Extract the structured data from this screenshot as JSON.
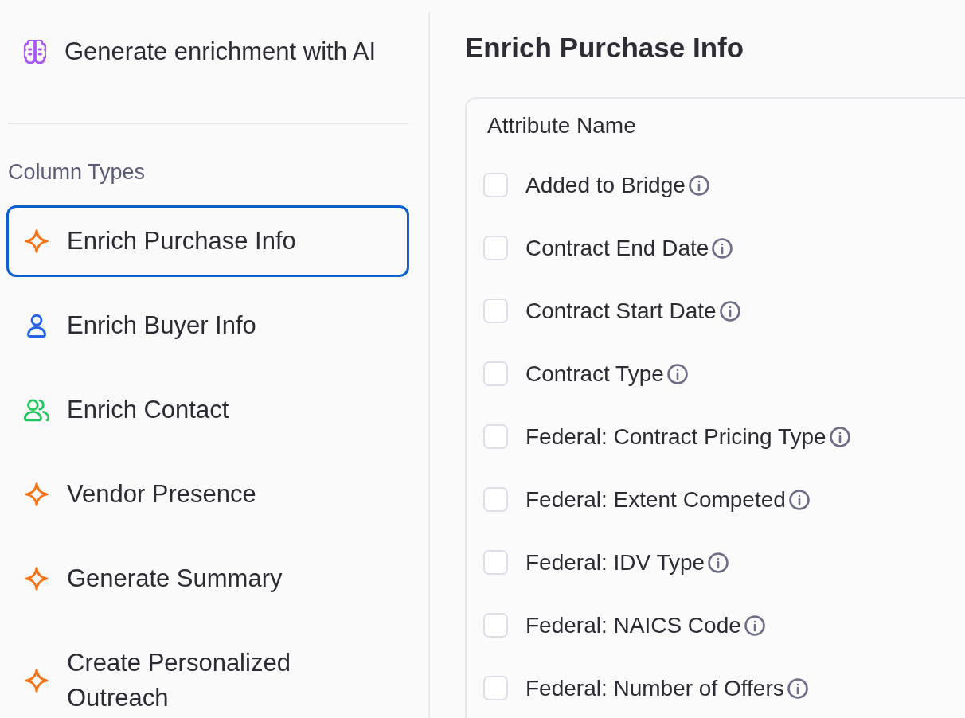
{
  "sidebar": {
    "ai_action": {
      "label": "Generate enrichment with AI"
    },
    "section_title": "Column Types",
    "items": [
      {
        "label": "Enrich Purchase Info",
        "kind": "ai",
        "selected": true
      },
      {
        "label": "Enrich Buyer Info",
        "kind": "buyer",
        "selected": false
      },
      {
        "label": "Enrich Contact",
        "kind": "contact",
        "selected": false
      },
      {
        "label": "Vendor Presence",
        "kind": "ai",
        "selected": false
      },
      {
        "label": "Generate Summary",
        "kind": "ai",
        "selected": false
      },
      {
        "label": "Create Personalized Outreach",
        "kind": "ai",
        "selected": false
      }
    ]
  },
  "panel": {
    "title": "Enrich Purchase Info",
    "table": {
      "column_header": "Attribute Name",
      "rows": [
        {
          "label": "Added to Bridge",
          "checked": false
        },
        {
          "label": "Contract End Date",
          "checked": false
        },
        {
          "label": "Contract Start Date",
          "checked": false
        },
        {
          "label": "Contract Type",
          "checked": false
        },
        {
          "label": "Federal: Contract Pricing Type",
          "checked": false
        },
        {
          "label": "Federal: Extent Competed",
          "checked": false
        },
        {
          "label": "Federal: IDV Type",
          "checked": false
        },
        {
          "label": "Federal: NAICS Code",
          "checked": false
        },
        {
          "label": "Federal: Number of Offers",
          "checked": false
        }
      ]
    }
  }
}
